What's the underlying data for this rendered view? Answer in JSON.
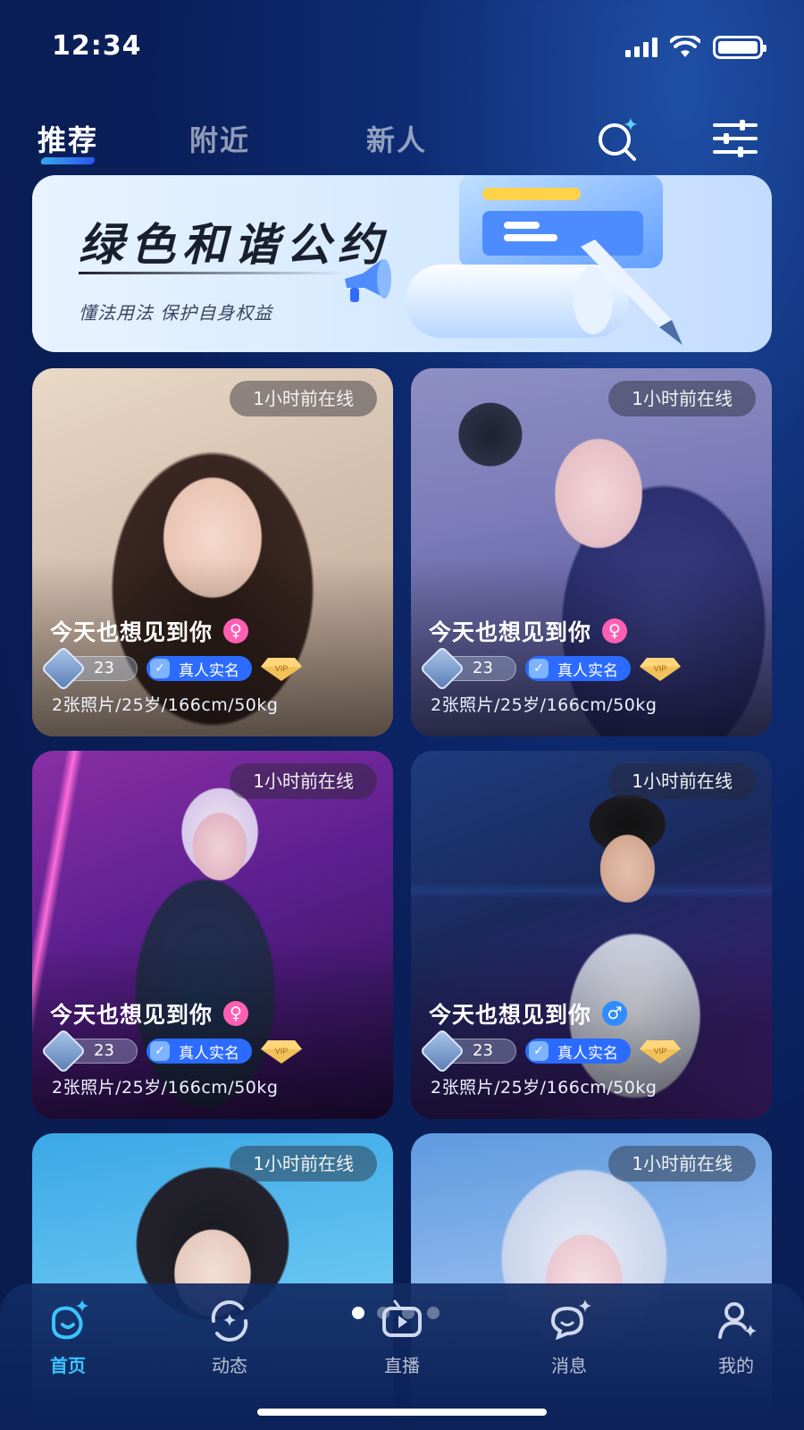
{
  "status_bar": {
    "time": "12:34"
  },
  "top_nav": {
    "tabs": [
      {
        "label": "推荐",
        "active": true
      },
      {
        "label": "附近",
        "active": false
      },
      {
        "label": "新人",
        "active": false
      }
    ],
    "icons": [
      "search-sparkle-icon",
      "filter-sliders-icon"
    ]
  },
  "banner": {
    "title": "绿色和谐公约",
    "subtitle": "懂法用法 保护自身权益"
  },
  "cards": [
    {
      "online": "1小时前在线",
      "name": "今天也想见到你",
      "gender": "♀",
      "level": "23",
      "verified": "真人实名",
      "vip": "VIP",
      "stats": "2张照片/25岁/166cm/50kg"
    },
    {
      "online": "1小时前在线",
      "name": "今天也想见到你",
      "gender": "♀",
      "level": "23",
      "verified": "真人实名",
      "vip": "VIP",
      "stats": "2张照片/25岁/166cm/50kg"
    },
    {
      "online": "1小时前在线",
      "name": "今天也想见到你",
      "gender": "♀",
      "level": "23",
      "verified": "真人实名",
      "vip": "VIP",
      "stats": "2张照片/25岁/166cm/50kg"
    },
    {
      "online": "1小时前在线",
      "name": "今天也想见到你",
      "gender": "♂",
      "level": "23",
      "verified": "真人实名",
      "vip": "VIP",
      "stats": "2张照片/25岁/166cm/50kg"
    },
    {
      "online": "1小时前在线"
    },
    {
      "online": "1小时前在线"
    }
  ],
  "tab_bar": {
    "items": [
      {
        "label": "首页",
        "icon": "home-icon",
        "active": true
      },
      {
        "label": "动态",
        "icon": "moments-icon",
        "active": false
      },
      {
        "label": "直播",
        "icon": "live-icon",
        "active": false
      },
      {
        "label": "消息",
        "icon": "message-icon",
        "active": false
      },
      {
        "label": "我的",
        "icon": "profile-icon",
        "active": false
      }
    ]
  },
  "colors": {
    "accent": "#3cc3ff",
    "female": "#ff5fb3",
    "male": "#2f8cff",
    "verified": "#2c6bff"
  }
}
